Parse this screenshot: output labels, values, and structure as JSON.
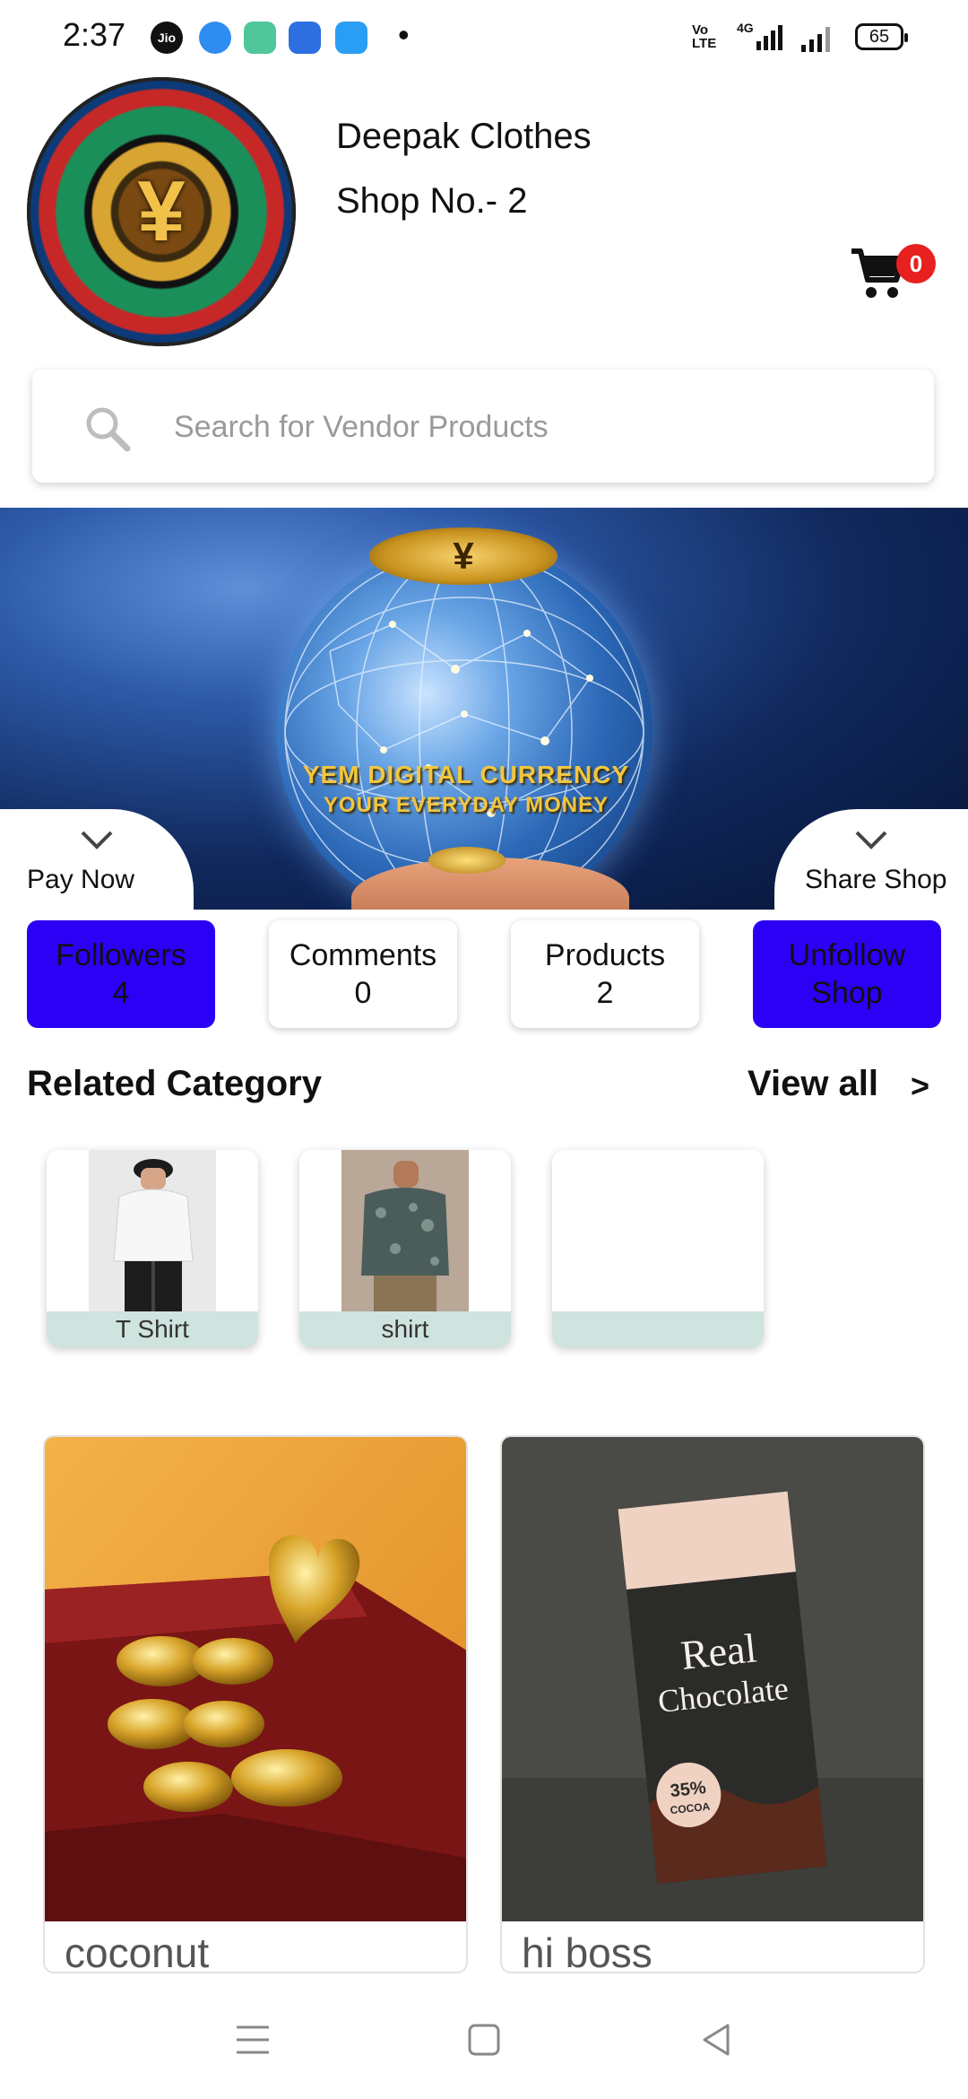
{
  "status_bar": {
    "time": "2:37",
    "carrier_icon": "Jio",
    "notification_dot": "•",
    "network_label": "4G",
    "volte_label": "Vo LTE",
    "battery": "65"
  },
  "header": {
    "shop_name": "Deepak Clothes",
    "shop_number": "Shop No.- 2",
    "cart_count": "0",
    "logo_symbol": "¥"
  },
  "search": {
    "placeholder": "Search for Vendor Products"
  },
  "banner": {
    "coin_text": "¥",
    "line1": "YEM DIGITAL CURRENCY",
    "line2": "YOUR EVERYDAY MONEY"
  },
  "tabs": {
    "pay_now": "Pay Now",
    "share_shop": "Share Shop"
  },
  "stats": {
    "followers_label": "Followers",
    "followers_count": "4",
    "comments_label": "Comments",
    "comments_count": "0",
    "products_label": "Products",
    "products_count": "2",
    "unfollow_line1": "Unfollow",
    "unfollow_line2": "Shop"
  },
  "related": {
    "title": "Related Category",
    "view_all": "View all",
    "arrow": ">",
    "categories": [
      {
        "label": "T Shirt"
      },
      {
        "label": "shirt"
      },
      {
        "label": ""
      }
    ]
  },
  "products": [
    {
      "name": "coconut"
    },
    {
      "name": "hi boss",
      "package_text_1": "Real",
      "package_text_2": "Chocolate",
      "badge_pct": "35%",
      "badge_label": "COCOA"
    }
  ],
  "colors": {
    "accent_blue": "#2b00f5",
    "badge_red": "#e82020",
    "category_label_bg": "#cfe3df"
  }
}
